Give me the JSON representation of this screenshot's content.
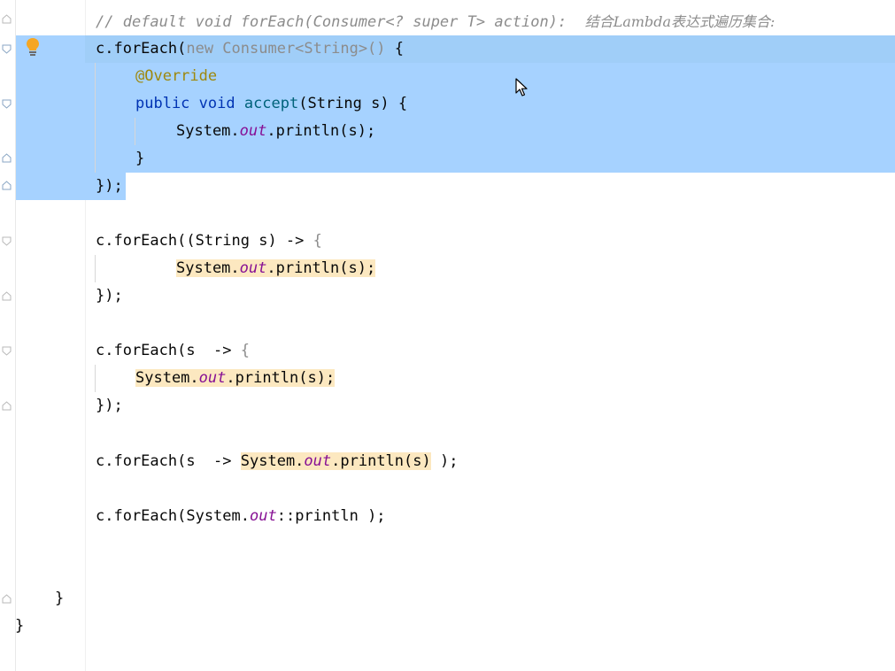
{
  "editor": {
    "lines": [
      {
        "id": "comment",
        "segments": [
          {
            "t": "// default void forEach(Consumer<? super T> action):  ",
            "c": "cmt"
          },
          {
            "t": "结合Lambda表达式遍历集合:",
            "c": "cjk"
          }
        ]
      },
      {
        "id": "l1",
        "segments": [
          {
            "t": "c.forEach(",
            "c": ""
          },
          {
            "t": "new Consumer<String>()",
            "c": "gray"
          },
          {
            "t": " {",
            "c": ""
          }
        ]
      },
      {
        "id": "l2",
        "segments": [
          {
            "t": "@Override",
            "c": "anno"
          }
        ]
      },
      {
        "id": "l3",
        "segments": [
          {
            "t": "public void ",
            "c": "kw"
          },
          {
            "t": "accept",
            "c": "fn"
          },
          {
            "t": "(String s) {",
            "c": ""
          }
        ]
      },
      {
        "id": "l4",
        "segments": [
          {
            "t": "System.",
            "c": ""
          },
          {
            "t": "out",
            "c": "fld"
          },
          {
            "t": ".println(s);",
            "c": ""
          }
        ]
      },
      {
        "id": "l5",
        "segments": [
          {
            "t": "}",
            "c": ""
          }
        ]
      },
      {
        "id": "l6",
        "segments": [
          {
            "t": "});",
            "c": ""
          }
        ]
      },
      {
        "id": "l7",
        "segments": [
          {
            "t": "c.forEach((String s) -> ",
            "c": ""
          },
          {
            "t": "{",
            "c": "gray"
          }
        ]
      },
      {
        "id": "l8",
        "segments": [
          {
            "t": "System.",
            "c": "hl"
          },
          {
            "t": "out",
            "c": "fld hl"
          },
          {
            "t": ".println(s);",
            "c": "hl"
          }
        ]
      },
      {
        "id": "l9",
        "segments": [
          {
            "t": "});",
            "c": ""
          }
        ]
      },
      {
        "id": "l10",
        "segments": [
          {
            "t": "c.forEach(s  -> ",
            "c": ""
          },
          {
            "t": "{",
            "c": "gray"
          }
        ]
      },
      {
        "id": "l11",
        "segments": [
          {
            "t": "System.",
            "c": "hl"
          },
          {
            "t": "out",
            "c": "fld hl"
          },
          {
            "t": ".println(s);",
            "c": "hl"
          }
        ]
      },
      {
        "id": "l12",
        "segments": [
          {
            "t": "});",
            "c": ""
          }
        ]
      },
      {
        "id": "l13",
        "segments": [
          {
            "t": "c.forEach(s  -> ",
            "c": ""
          },
          {
            "t": "System.",
            "c": "hl"
          },
          {
            "t": "out",
            "c": "fld hl"
          },
          {
            "t": ".println(s)",
            "c": "hl"
          },
          {
            "t": " );",
            "c": ""
          }
        ]
      },
      {
        "id": "l14",
        "segments": [
          {
            "t": "c.forEach(System.",
            "c": ""
          },
          {
            "t": "out",
            "c": "fld"
          },
          {
            "t": "::println );",
            "c": ""
          }
        ]
      },
      {
        "id": "l15",
        "segments": [
          {
            "t": "}",
            "c": ""
          }
        ]
      },
      {
        "id": "l16",
        "segments": [
          {
            "t": "}",
            "c": ""
          }
        ]
      }
    ]
  },
  "icons": {
    "intention": "lightbulb-icon",
    "fold": "fold-marker-icon",
    "pointer": "mouse-pointer-icon"
  },
  "colors": {
    "selection": "#a6d2ff",
    "highlight": "#fce8c0",
    "keyword": "#0033b3",
    "field": "#871094",
    "annotation": "#9e880d",
    "comment": "#8c8c8c",
    "bulb": "#f5a623"
  }
}
